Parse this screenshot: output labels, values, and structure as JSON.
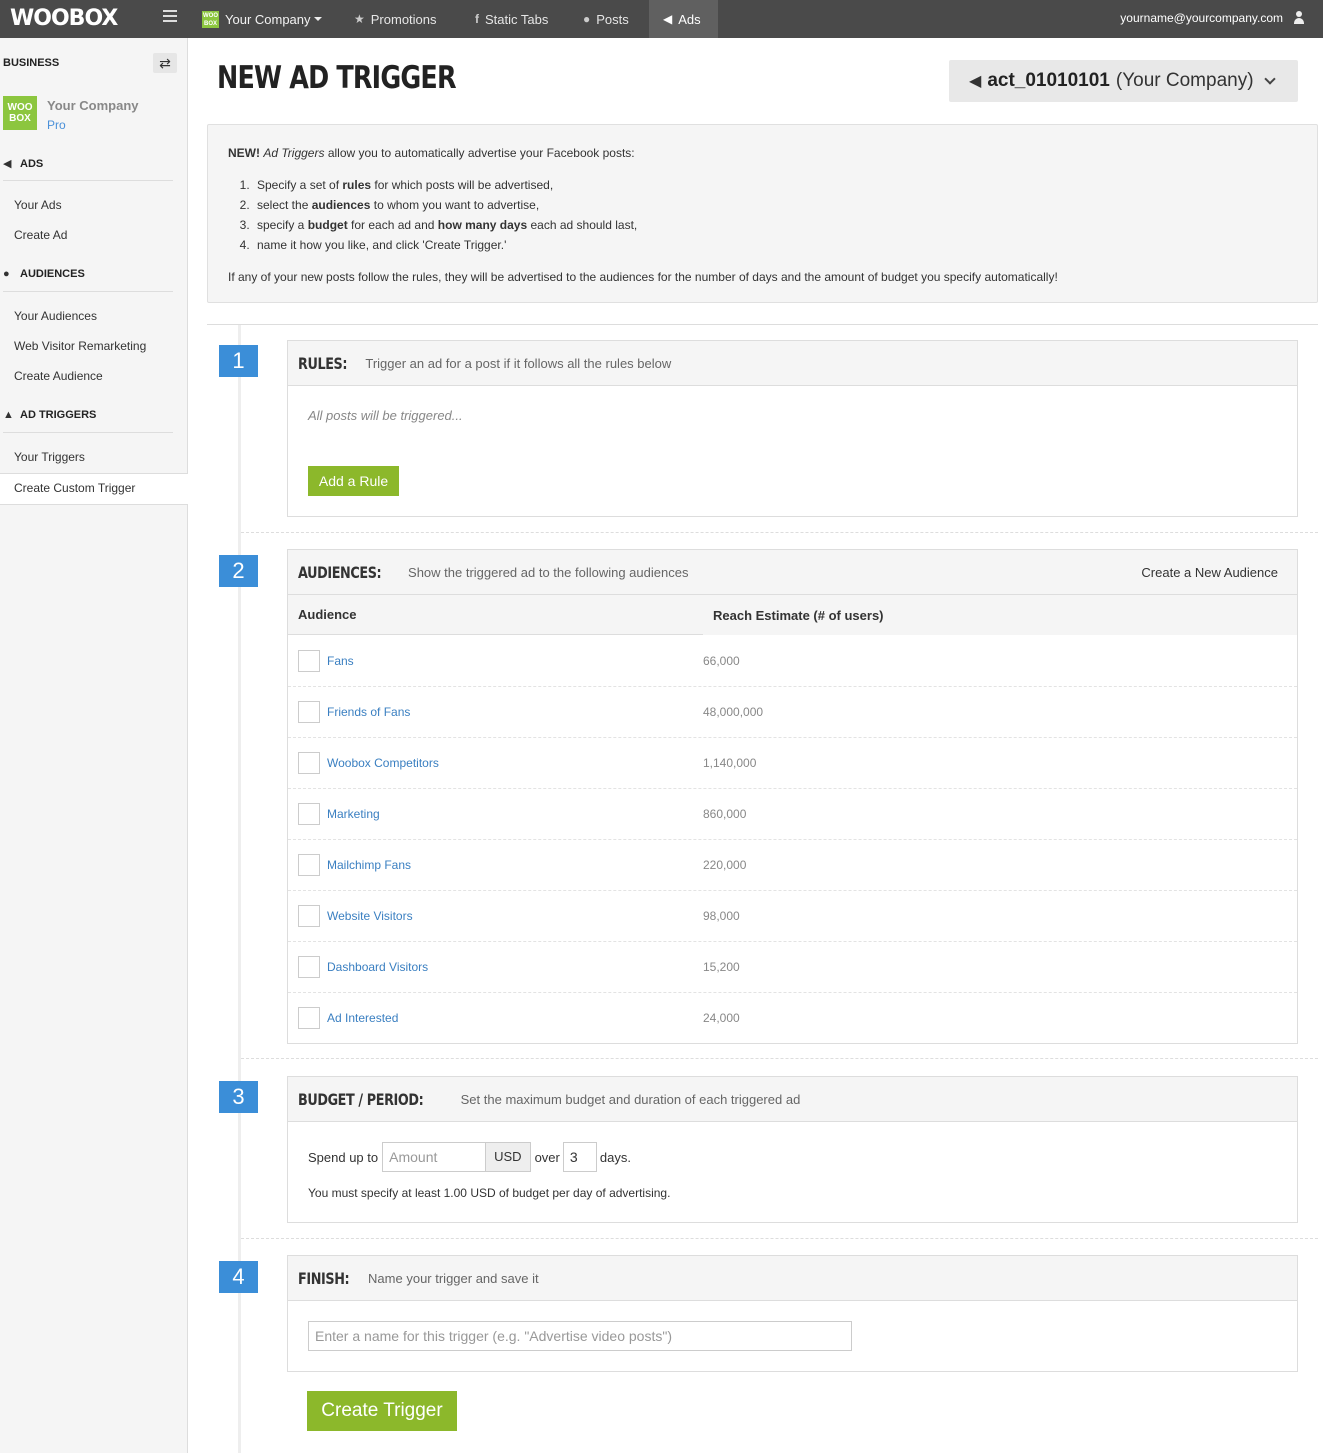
{
  "topnav": {
    "logo": "WOOBOX",
    "company": "Your Company",
    "company_logo": "WOO BOX",
    "items": [
      {
        "label": "Promotions",
        "icon": "star-icon"
      },
      {
        "label": "Static Tabs",
        "icon": "facebook-icon"
      },
      {
        "label": "Posts",
        "icon": "comment-icon"
      },
      {
        "label": "Ads",
        "icon": "megaphone-icon"
      }
    ],
    "user_email": "yourname@yourcompany.com"
  },
  "sidebar": {
    "business_label": "BUSINESS",
    "company_name": "Your Company",
    "company_plan": "Pro",
    "logo_text": "WOO BOX",
    "sections": [
      {
        "title": "ADS",
        "icon": "megaphone-icon",
        "links": [
          "Your Ads",
          "Create Ad"
        ]
      },
      {
        "title": "AUDIENCES",
        "icon": "user-icon",
        "links": [
          "Your Audiences",
          "Web Visitor Remarketing",
          "Create Audience"
        ]
      },
      {
        "title": "AD TRIGGERS",
        "icon": "flask-icon",
        "links": [
          "Your Triggers",
          "Create Custom Trigger"
        ]
      }
    ]
  },
  "page": {
    "title": "NEW AD TRIGGER",
    "account_id": "act_01010101",
    "account_name": "(Your Company)"
  },
  "info": {
    "new_label": "NEW!",
    "intro_em": "Ad Triggers",
    "intro_rest": " allow you to automatically advertise your Facebook posts:",
    "steps": [
      {
        "pre": "Specify a set of ",
        "b": "rules",
        "post": " for which posts will be advertised,",
        "b2": "",
        "post2": ""
      },
      {
        "pre": "select the ",
        "b": "audiences",
        "post": " to whom you want to advertise,",
        "b2": "",
        "post2": ""
      },
      {
        "pre": "specify a ",
        "b": "budget",
        "post": " for each ad and ",
        "b2": "how many days",
        "post2": " each ad should last,"
      },
      {
        "pre": "name it how you like, and click 'Create Trigger.'",
        "b": "",
        "post": "",
        "b2": "",
        "post2": ""
      }
    ],
    "footer": "If any of your new posts follow the rules, they will be advertised to the audiences for the number of days and the amount of budget you specify automatically!"
  },
  "steps": {
    "rules": {
      "num": "1",
      "title": "RULES:",
      "subtitle": "Trigger an ad for a post if it follows all the rules below",
      "empty": "All posts will be triggered...",
      "add_button": "Add a Rule"
    },
    "audiences": {
      "num": "2",
      "title": "AUDIENCES:",
      "subtitle": "Show the triggered ad to the following audiences",
      "create_link": "Create a New Audience",
      "col_audience": "Audience",
      "col_reach": "Reach Estimate (# of users)",
      "rows": [
        {
          "name": "Fans",
          "reach": "66,000"
        },
        {
          "name": "Friends of Fans",
          "reach": "48,000,000"
        },
        {
          "name": "Woobox Competitors",
          "reach": "1,140,000"
        },
        {
          "name": "Marketing",
          "reach": "860,000"
        },
        {
          "name": "Mailchimp Fans",
          "reach": "220,000"
        },
        {
          "name": "Website Visitors",
          "reach": "98,000"
        },
        {
          "name": "Dashboard Visitors",
          "reach": "15,200"
        },
        {
          "name": "Ad Interested",
          "reach": "24,000"
        }
      ]
    },
    "budget": {
      "num": "3",
      "title": "BUDGET / PERIOD:",
      "subtitle": "Set the maximum budget and duration of each triggered ad",
      "spend_label": "Spend up to",
      "amount_placeholder": "Amount",
      "currency": "USD",
      "over_label": "over",
      "days_value": "3",
      "days_label": "days.",
      "note": "You must specify at least 1.00 USD of budget per day of advertising."
    },
    "finish": {
      "num": "4",
      "title": "FINISH:",
      "subtitle": "Name your trigger and save it",
      "name_placeholder": "Enter a name for this trigger (e.g. \"Advertise video posts\")",
      "create_button": "Create Trigger"
    }
  }
}
